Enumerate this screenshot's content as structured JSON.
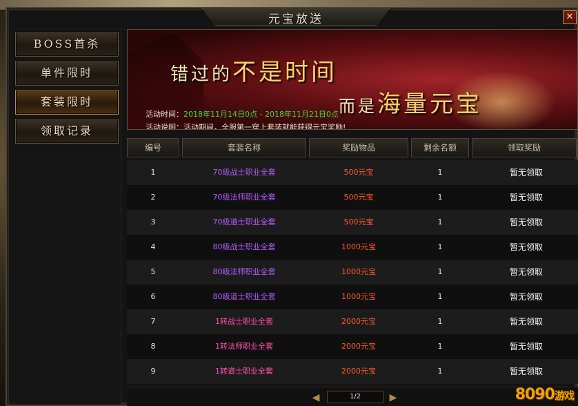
{
  "window": {
    "title": "元宝放送",
    "close_glyph": "✕"
  },
  "sidebar": {
    "items": [
      {
        "label": "BOSS首杀",
        "active": false
      },
      {
        "label": "单件限时",
        "active": false
      },
      {
        "label": "套装限时",
        "active": true
      },
      {
        "label": "领取记录",
        "active": false
      }
    ]
  },
  "banner": {
    "slogan_1_prefix": "错过的",
    "slogan_1_big": "不是时间",
    "slogan_2_prefix": "而是",
    "slogan_2_big": "海量元宝",
    "time_label": "活动时间：",
    "time_value": "2018年11月14日0点 - 2018年11月21日0点",
    "desc": "活动说明：活动期间，全服第一穿上套装就能获得元宝奖励!"
  },
  "table": {
    "headers": [
      "编号",
      "套装名称",
      "奖励物品",
      "剩余名额",
      "领取奖励"
    ],
    "rows": [
      {
        "id": "1",
        "name": "70级战士职业全套",
        "reward": "500元宝",
        "remaining": "1",
        "status": "暂无领取",
        "name_color": "#b65cff"
      },
      {
        "id": "2",
        "name": "70级法师职业全套",
        "reward": "500元宝",
        "remaining": "1",
        "status": "暂无领取",
        "name_color": "#b65cff"
      },
      {
        "id": "3",
        "name": "70级道士职业全套",
        "reward": "500元宝",
        "remaining": "1",
        "status": "暂无领取",
        "name_color": "#b65cff"
      },
      {
        "id": "4",
        "name": "80级战士职业全套",
        "reward": "1000元宝",
        "remaining": "1",
        "status": "暂无领取",
        "name_color": "#b65cff"
      },
      {
        "id": "5",
        "name": "80级法师职业全套",
        "reward": "1000元宝",
        "remaining": "1",
        "status": "暂无领取",
        "name_color": "#b65cff"
      },
      {
        "id": "6",
        "name": "80级道士职业全套",
        "reward": "1000元宝",
        "remaining": "1",
        "status": "暂无领取",
        "name_color": "#b65cff"
      },
      {
        "id": "7",
        "name": "1转战士职业全套",
        "reward": "2000元宝",
        "remaining": "1",
        "status": "暂无领取",
        "name_color": "#ff4fb0"
      },
      {
        "id": "8",
        "name": "1转法师职业全套",
        "reward": "2000元宝",
        "remaining": "1",
        "status": "暂无领取",
        "name_color": "#ff4fb0"
      },
      {
        "id": "9",
        "name": "1转道士职业全套",
        "reward": "2000元宝",
        "remaining": "1",
        "status": "暂无领取",
        "name_color": "#ff4fb0"
      }
    ]
  },
  "pager": {
    "current_label": "1/2",
    "prev_glyph": "◀",
    "next_glyph": "▶"
  },
  "watermark": {
    "digits": "8090",
    "cn": "游戏"
  }
}
